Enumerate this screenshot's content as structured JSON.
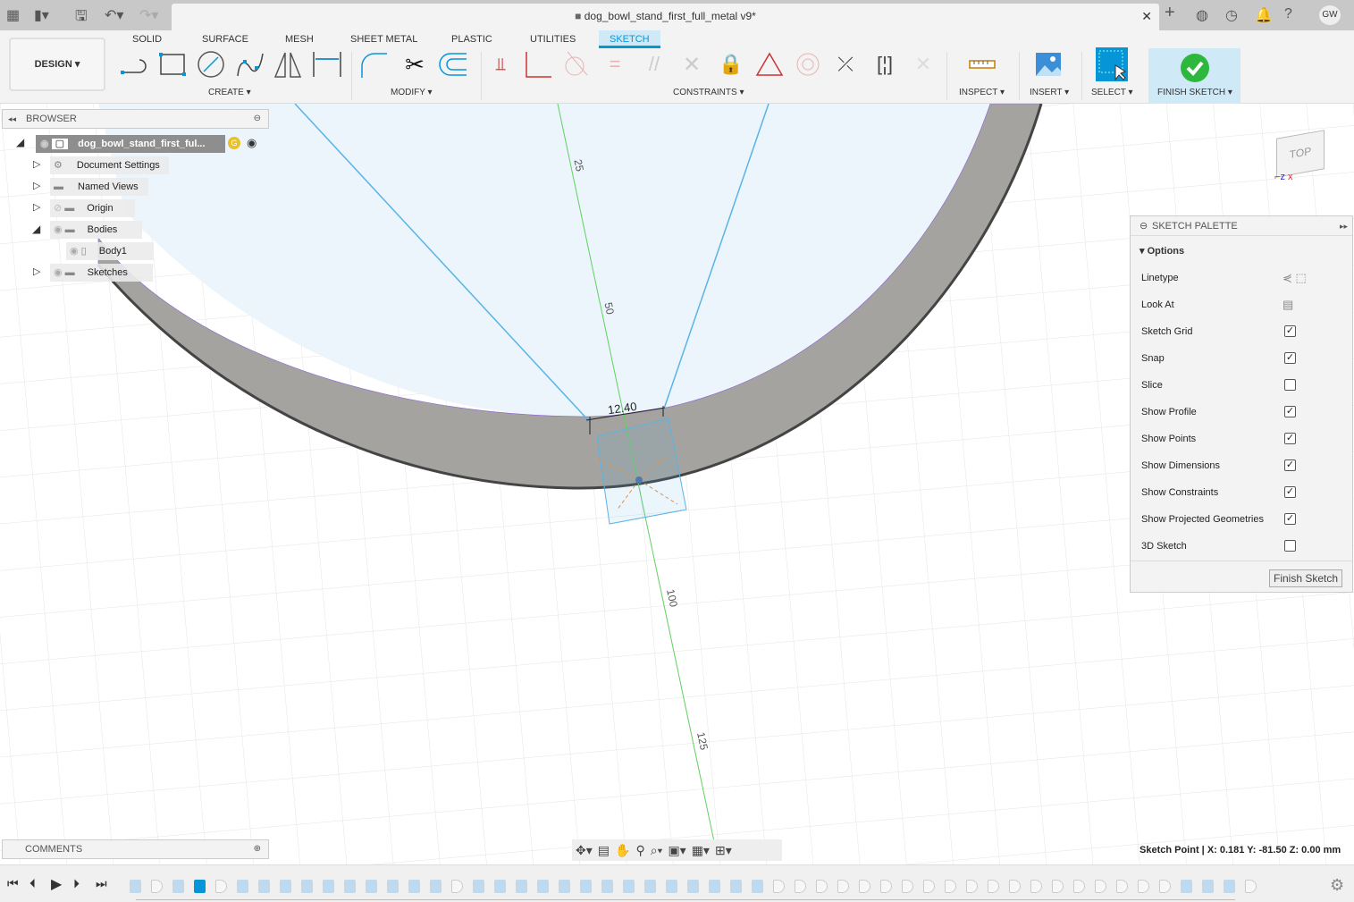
{
  "title_bar": {
    "document_title": "dog_bowl_stand_first_full_metal v9*",
    "user_initials": "GW"
  },
  "ribbon": {
    "workspace": "DESIGN",
    "tabs": [
      "SOLID",
      "SURFACE",
      "MESH",
      "SHEET METAL",
      "PLASTIC",
      "UTILITIES",
      "SKETCH"
    ],
    "active_tab": "SKETCH",
    "groups": {
      "create": "CREATE",
      "modify": "MODIFY",
      "constraints": "CONSTRAINTS",
      "inspect": "INSPECT",
      "insert": "INSERT",
      "select": "SELECT",
      "finish": "FINISH SKETCH"
    }
  },
  "browser": {
    "title": "BROWSER",
    "items": [
      {
        "label": "dog_bowl_stand_first_ful..."
      },
      {
        "label": "Document Settings"
      },
      {
        "label": "Named Views"
      },
      {
        "label": "Origin"
      },
      {
        "label": "Bodies"
      },
      {
        "label": "Body1"
      },
      {
        "label": "Sketches"
      }
    ]
  },
  "viewport": {
    "dimension": "12.40",
    "axis_labels": [
      "25",
      "50",
      "100",
      "125"
    ],
    "viewcube": {
      "face": "TOP"
    }
  },
  "sketch_palette": {
    "title": "SKETCH PALETTE",
    "section": "Options",
    "options": [
      {
        "label": "Linetype",
        "type": "icons"
      },
      {
        "label": "Look At",
        "type": "icon"
      },
      {
        "label": "Sketch Grid",
        "checked": true
      },
      {
        "label": "Snap",
        "checked": true
      },
      {
        "label": "Slice",
        "checked": false
      },
      {
        "label": "Show Profile",
        "checked": true
      },
      {
        "label": "Show Points",
        "checked": true
      },
      {
        "label": "Show Dimensions",
        "checked": true
      },
      {
        "label": "Show Constraints",
        "checked": true
      },
      {
        "label": "Show Projected Geometries",
        "checked": true
      },
      {
        "label": "3D Sketch",
        "checked": false
      }
    ],
    "finish_button": "Finish Sketch"
  },
  "comments": {
    "title": "COMMENTS"
  },
  "status": {
    "text": "Sketch Point | X: 0.181 Y: -81.50 Z: 0.00 mm"
  },
  "timeline": {
    "items": [
      "body",
      "sketch",
      "body",
      "sketch-active",
      "sketch",
      "body",
      "body",
      "body",
      "body",
      "body",
      "body",
      "body",
      "body",
      "body",
      "body",
      "sketch",
      "body",
      "body",
      "body",
      "body",
      "body",
      "body",
      "body",
      "body",
      "body",
      "body",
      "body",
      "body",
      "body",
      "body",
      "sketch",
      "sketch",
      "sketch",
      "sketch",
      "sketch",
      "sketch",
      "sketch",
      "sketch",
      "sketch",
      "sketch",
      "sketch",
      "sketch",
      "sketch",
      "sketch",
      "sketch",
      "sketch",
      "sketch",
      "sketch",
      "sketch",
      "body",
      "body",
      "body",
      "sketch"
    ]
  },
  "colors": {
    "accent": "#0696d7",
    "finish_green": "#2db83d",
    "bowl": "#a4a39f",
    "sketch_fill": "#eaf4fb",
    "sketch_line": "#5ab4e5"
  }
}
